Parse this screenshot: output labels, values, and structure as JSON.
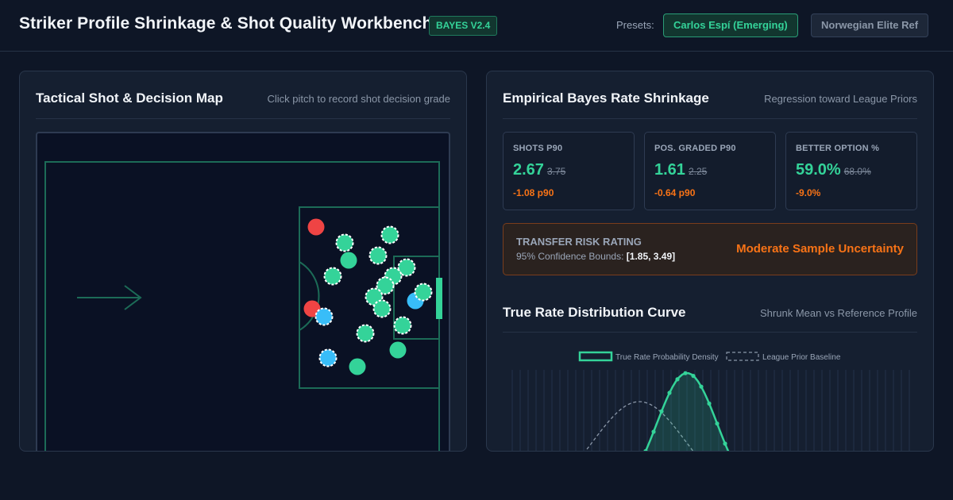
{
  "header": {
    "title": "Striker Profile Shrinkage & Shot Quality Workbench",
    "version": "BAYES V2.4",
    "presets_label": "Presets:",
    "presets": [
      {
        "label": "Carlos Espí (Emerging)",
        "active": true
      },
      {
        "label": "Norwegian Elite Ref",
        "active": false
      }
    ]
  },
  "shot_map": {
    "title": "Tactical Shot & Decision Map",
    "subtitle": "Click pitch to record shot decision grade"
  },
  "shrinkage": {
    "title": "Empirical Bayes Rate Shrinkage",
    "subtitle": "Regression toward League Priors",
    "stats": [
      {
        "label": "SHOTS P90",
        "value": "2.67",
        "raw": "3.75",
        "delta": "-1.08 p90"
      },
      {
        "label": "POS. GRADED P90",
        "value": "1.61",
        "raw": "2.25",
        "delta": "-0.64 p90"
      },
      {
        "label": "BETTER OPTION %",
        "value": "59.0%",
        "raw": "68.0%",
        "delta": "-9.0%"
      }
    ]
  },
  "risk": {
    "title": "TRANSFER RISK RATING",
    "bounds_label": "95% Confidence Bounds:",
    "bounds_value": "[1.85, 3.49]",
    "level": "Moderate Sample Uncertainty"
  },
  "distribution": {
    "title": "True Rate Distribution Curve",
    "subtitle": "Shrunk Mean vs Reference Profile",
    "legend": [
      "True Rate Probability Density",
      "League Prior Baseline"
    ]
  },
  "colors": {
    "accent": "#34d399",
    "warning": "#f97316",
    "shot_red": "#ef4444",
    "shot_blue": "#38bdf8"
  }
}
